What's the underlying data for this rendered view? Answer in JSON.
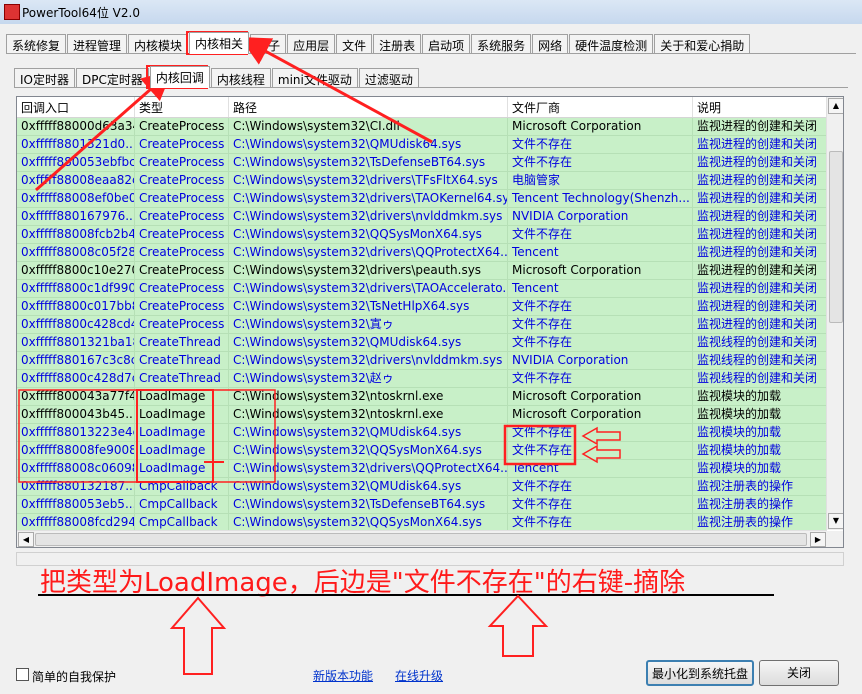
{
  "window": {
    "title": "PowerTool64位 V2.0"
  },
  "main_tabs": [
    {
      "label": "系统修复"
    },
    {
      "label": "进程管理"
    },
    {
      "label": "内核模块"
    },
    {
      "label": "内核相关"
    },
    {
      "label": "钩子"
    },
    {
      "label": "应用层"
    },
    {
      "label": "文件"
    },
    {
      "label": "注册表"
    },
    {
      "label": "启动项"
    },
    {
      "label": "系统服务"
    },
    {
      "label": "网络"
    },
    {
      "label": "硬件温度检测"
    },
    {
      "label": "关于和爱心捐助"
    }
  ],
  "main_active": "内核相关",
  "sub_tabs": [
    {
      "label": "IO定时器"
    },
    {
      "label": "DPC定时器"
    },
    {
      "label": "内核回调"
    },
    {
      "label": "内核线程"
    },
    {
      "label": "mini文件驱动"
    },
    {
      "label": "过滤驱动"
    }
  ],
  "sub_active": "内核回调",
  "columns": [
    "回调入口",
    "类型",
    "路径",
    "文件厂商",
    "说明"
  ],
  "rows": [
    {
      "entry": "0xfffff88000d63a34",
      "type": "CreateProcess",
      "path": "C:\\Windows\\system32\\CI.dll",
      "vendor": "Microsoft Corporation",
      "desc": "监视进程的创建和关闭",
      "color": "black"
    },
    {
      "entry": "0xfffff8801321d0...",
      "type": "CreateProcess",
      "path": "C:\\Windows\\system32\\QMUdisk64.sys",
      "vendor": "文件不存在",
      "desc": "监视进程的创建和关闭",
      "color": "blue"
    },
    {
      "entry": "0xfffff880053ebfbc",
      "type": "CreateProcess",
      "path": "C:\\Windows\\system32\\TsDefenseBT64.sys",
      "vendor": "文件不存在",
      "desc": "监视进程的创建和关闭",
      "color": "blue"
    },
    {
      "entry": "0xfffff88008eaa82c",
      "type": "CreateProcess",
      "path": "C:\\Windows\\system32\\drivers\\TFsFltX64.sys",
      "vendor": "电脑管家",
      "desc": "监视进程的创建和关闭",
      "color": "blue"
    },
    {
      "entry": "0xfffff88008ef0be0",
      "type": "CreateProcess",
      "path": "C:\\Windows\\system32\\drivers\\TAOKernel64.sys",
      "vendor": "Tencent Technology(Shenzh...",
      "desc": "监视进程的创建和关闭",
      "color": "blue"
    },
    {
      "entry": "0xfffff880167976...",
      "type": "CreateProcess",
      "path": "C:\\Windows\\system32\\drivers\\nvlddmkm.sys",
      "vendor": "NVIDIA Corporation",
      "desc": "监视进程的创建和关闭",
      "color": "blue"
    },
    {
      "entry": "0xfffff88008fcb2b4",
      "type": "CreateProcess",
      "path": "C:\\Windows\\system32\\QQSysMonX64.sys",
      "vendor": "文件不存在",
      "desc": "监视进程的创建和关闭",
      "color": "blue"
    },
    {
      "entry": "0xfffff88008c05f28",
      "type": "CreateProcess",
      "path": "C:\\Windows\\system32\\drivers\\QQProtectX64....",
      "vendor": "Tencent",
      "desc": "监视进程的创建和关闭",
      "color": "blue"
    },
    {
      "entry": "0xfffff8800c10e270",
      "type": "CreateProcess",
      "path": "C:\\Windows\\system32\\drivers\\peauth.sys",
      "vendor": "Microsoft Corporation",
      "desc": "监视进程的创建和关闭",
      "color": "black"
    },
    {
      "entry": "0xfffff8800c1df990",
      "type": "CreateProcess",
      "path": "C:\\Windows\\system32\\drivers\\TAOAccelerato...",
      "vendor": "Tencent",
      "desc": "监视进程的创建和关闭",
      "color": "blue"
    },
    {
      "entry": "0xfffff8800c017bb8",
      "type": "CreateProcess",
      "path": "C:\\Windows\\system32\\TsNetHlpX64.sys",
      "vendor": "文件不存在",
      "desc": "监视进程的创建和关闭",
      "color": "blue"
    },
    {
      "entry": "0xfffff8800c428cd4",
      "type": "CreateProcess",
      "path": "C:\\Windows\\system32\\寘ゥ",
      "vendor": "文件不存在",
      "desc": "监视进程的创建和关闭",
      "color": "blue"
    },
    {
      "entry": "0xfffff8801321ba18",
      "type": "CreateThread",
      "path": "C:\\Windows\\system32\\QMUdisk64.sys",
      "vendor": "文件不存在",
      "desc": "监视线程的创建和关闭",
      "color": "blue"
    },
    {
      "entry": "0xfffff880167c3c8c",
      "type": "CreateThread",
      "path": "C:\\Windows\\system32\\drivers\\nvlddmkm.sys",
      "vendor": "NVIDIA Corporation",
      "desc": "监视线程的创建和关闭",
      "color": "blue"
    },
    {
      "entry": "0xfffff8800c428d7c",
      "type": "CreateThread",
      "path": "C:\\Windows\\system32\\赵ゥ",
      "vendor": "文件不存在",
      "desc": "监视线程的创建和关闭",
      "color": "blue"
    },
    {
      "entry": "0xfffff800043a77f4",
      "type": "LoadImage",
      "path": "C:\\Windows\\system32\\ntoskrnl.exe",
      "vendor": "Microsoft Corporation",
      "desc": "监视模块的加载",
      "color": "black"
    },
    {
      "entry": "0xfffff800043b45...",
      "type": "LoadImage",
      "path": "C:\\Windows\\system32\\ntoskrnl.exe",
      "vendor": "Microsoft Corporation",
      "desc": "监视模块的加载",
      "color": "black"
    },
    {
      "entry": "0xfffff88013223e4c",
      "type": "LoadImage",
      "path": "C:\\Windows\\system32\\QMUdisk64.sys",
      "vendor": "文件不存在",
      "desc": "监视模块的加载",
      "color": "blue"
    },
    {
      "entry": "0xfffff88008fe9008",
      "type": "LoadImage",
      "path": "C:\\Windows\\system32\\QQSysMonX64.sys",
      "vendor": "文件不存在",
      "desc": "监视模块的加载",
      "color": "blue"
    },
    {
      "entry": "0xfffff88008c06098",
      "type": "LoadImage",
      "path": "C:\\Windows\\system32\\drivers\\QQProtectX64....",
      "vendor": "Tencent",
      "desc": "监视模块的加载",
      "color": "blue"
    },
    {
      "entry": "0xfffff880132187...",
      "type": "CmpCallback",
      "path": "C:\\Windows\\system32\\QMUdisk64.sys",
      "vendor": "文件不存在",
      "desc": "监视注册表的操作",
      "color": "blue"
    },
    {
      "entry": "0xfffff880053eb5...",
      "type": "CmpCallback",
      "path": "C:\\Windows\\system32\\TsDefenseBT64.sys",
      "vendor": "文件不存在",
      "desc": "监视注册表的操作",
      "color": "blue"
    },
    {
      "entry": "0xfffff88008fcd294",
      "type": "CmpCallback",
      "path": "C:\\Windows\\system32\\QQSysMonX64.sys",
      "vendor": "文件不存在",
      "desc": "监视注册表的操作",
      "color": "blue"
    }
  ],
  "annotation": {
    "text": "把类型为LoadImage，后边是\"文件不存在\"的右键-摘除",
    "color": "#ff1a1a"
  },
  "bottom": {
    "self_protect_label": "简单的自我保护",
    "new_version_link": "新版本功能",
    "online_upgrade_link": "在线升级",
    "minimize_tray_button": "最小化到系统托盘",
    "close_button": "关闭"
  },
  "colors": {
    "row_bg": "#c8f0c8",
    "blue_text": "#0000e0",
    "arrow_red": "#ff2020"
  }
}
